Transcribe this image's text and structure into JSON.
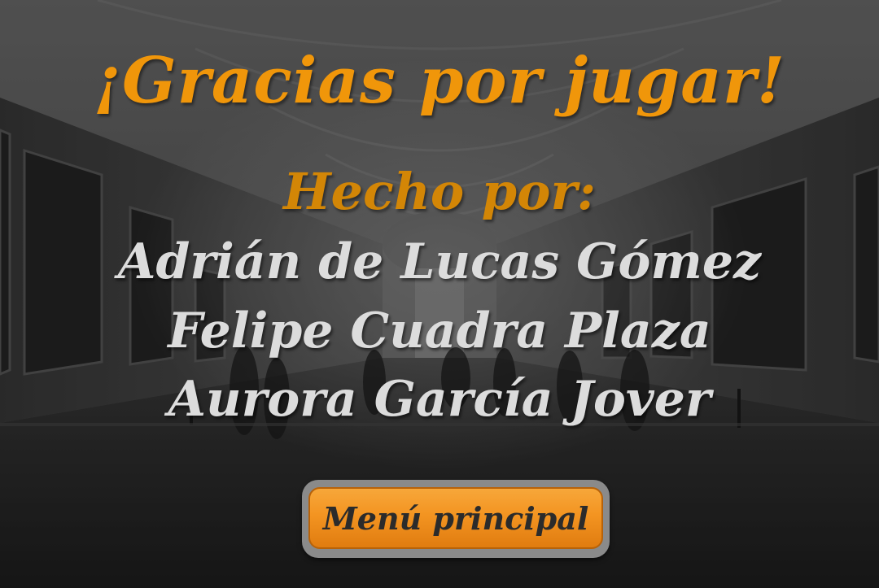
{
  "screen": {
    "title": "¡Gracias por jugar!",
    "made_by_label": "Hecho por:",
    "authors": [
      "Adrián de Lucas Gómez",
      "Felipe Cuadra Plaza",
      "Aurora García Jover"
    ],
    "menu_button_label": "Menú principal"
  },
  "colors": {
    "title": "#f0960a",
    "made_by": "#d38606",
    "authors": "#dcdcdc",
    "button": "#f39421"
  }
}
